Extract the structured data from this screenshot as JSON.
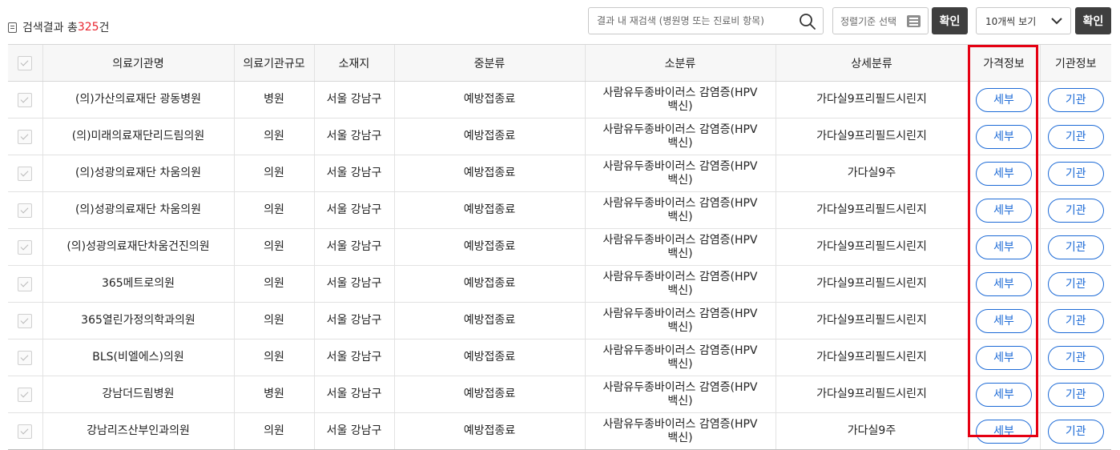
{
  "summary": {
    "prefix": "검색결과 총",
    "count": "325",
    "suffix": "건"
  },
  "search": {
    "placeholder": "결과 내 재검색 (병원명 또는 진료비 항목)",
    "value": ""
  },
  "sort": {
    "label": "정렬기준 선택",
    "confirm": "확인"
  },
  "page_size": {
    "selected": "10개씩 보기",
    "confirm": "확인"
  },
  "headers": [
    "의료기관명",
    "의료기관규모",
    "소재지",
    "중분류",
    "소분류",
    "상세분류",
    "가격정보",
    "기관정보"
  ],
  "button_labels": {
    "price": "세부",
    "institution": "기관"
  },
  "rows": [
    {
      "name": "(의)가산의료재단 광동병원",
      "size": "병원",
      "location": "서울 강남구",
      "mid": "예방접종료",
      "sub_1": "사람유두종바이러스 감염증(HPV",
      "sub_2": "백신)",
      "detail": "가다실9프리필드시린지"
    },
    {
      "name": "(의)미래의료재단리드림의원",
      "size": "의원",
      "location": "서울 강남구",
      "mid": "예방접종료",
      "sub_1": "사람유두종바이러스 감염증(HPV",
      "sub_2": "백신)",
      "detail": "가다실9프리필드시린지"
    },
    {
      "name": "(의)성광의료재단 차움의원",
      "size": "의원",
      "location": "서울 강남구",
      "mid": "예방접종료",
      "sub_1": "사람유두종바이러스 감염증(HPV",
      "sub_2": "백신)",
      "detail": "가다실9주"
    },
    {
      "name": "(의)성광의료재단 차움의원",
      "size": "의원",
      "location": "서울 강남구",
      "mid": "예방접종료",
      "sub_1": "사람유두종바이러스 감염증(HPV",
      "sub_2": "백신)",
      "detail": "가다실9프리필드시린지"
    },
    {
      "name": "(의)성광의료재단차움건진의원",
      "size": "의원",
      "location": "서울 강남구",
      "mid": "예방접종료",
      "sub_1": "사람유두종바이러스 감염증(HPV",
      "sub_2": "백신)",
      "detail": "가다실9프리필드시린지"
    },
    {
      "name": "365메트로의원",
      "size": "의원",
      "location": "서울 강남구",
      "mid": "예방접종료",
      "sub_1": "사람유두종바이러스 감염증(HPV",
      "sub_2": "백신)",
      "detail": "가다실9프리필드시린지"
    },
    {
      "name": "365열린가정의학과의원",
      "size": "의원",
      "location": "서울 강남구",
      "mid": "예방접종료",
      "sub_1": "사람유두종바이러스 감염증(HPV",
      "sub_2": "백신)",
      "detail": "가다실9프리필드시린지"
    },
    {
      "name": "BLS(비엘에스)의원",
      "size": "의원",
      "location": "서울 강남구",
      "mid": "예방접종료",
      "sub_1": "사람유두종바이러스 감염증(HPV",
      "sub_2": "백신)",
      "detail": "가다실9프리필드시린지"
    },
    {
      "name": "강남더드림병원",
      "size": "병원",
      "location": "서울 강남구",
      "mid": "예방접종료",
      "sub_1": "사람유두종바이러스 감염증(HPV",
      "sub_2": "백신)",
      "detail": "가다실9프리필드시린지"
    },
    {
      "name": "강남리즈산부인과의원",
      "size": "의원",
      "location": "서울 강남구",
      "mid": "예방접종료",
      "sub_1": "사람유두종바이러스 감염증(HPV",
      "sub_2": "백신)",
      "detail": "가다실9주"
    }
  ],
  "colors": {
    "accent": "#1c6ad6",
    "highlight": "#e50012",
    "count": "#e8252f",
    "dark_button": "#3f3f3f"
  }
}
